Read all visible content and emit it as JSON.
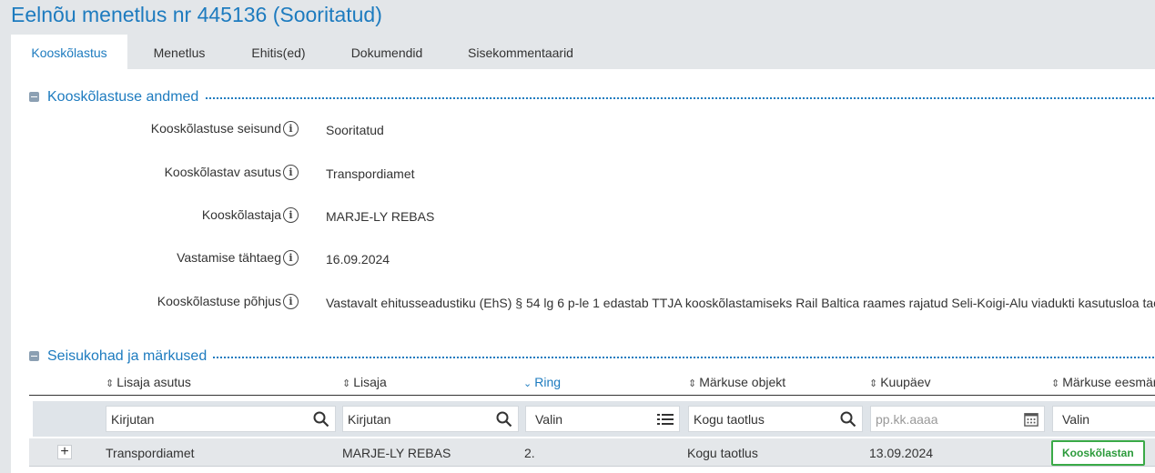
{
  "page": {
    "title": "Eelnõu menetlus nr 445136 (Sooritatud)"
  },
  "tabs": [
    {
      "label": "Kooskõlastus",
      "active": true
    },
    {
      "label": "Menetlus"
    },
    {
      "label": "Ehitis(ed)"
    },
    {
      "label": "Dokumendid"
    },
    {
      "label": "Sisekommentaarid"
    }
  ],
  "details": {
    "title": "Kooskõlastuse andmed",
    "fields": [
      {
        "label": "Kooskõlastuse seisund",
        "value": "Sooritatud"
      },
      {
        "label": "Kooskõlastav asutus",
        "value": "Transpordiamet"
      },
      {
        "label": "Kooskõlastaja",
        "value": "MARJE-LY REBAS"
      },
      {
        "label": "Vastamise tähtaeg",
        "value": "16.09.2024"
      },
      {
        "label": "Kooskõlastuse põhjus",
        "value": "Vastavalt ehitusseadustiku (EhS) § 54 lg 6 p-le 1 edastab TTJA kooskõlastamiseks Rail Baltica raames rajatud Seli-Koigi-Alu viadukti kasutusloa taotluse"
      }
    ]
  },
  "remarks": {
    "title": "Seisukohad ja märkused",
    "columns": [
      {
        "label": "Lisaja asutus",
        "sort": "none"
      },
      {
        "label": "Lisaja",
        "sort": "none"
      },
      {
        "label": "Ring",
        "sort": "desc"
      },
      {
        "label": "Märkuse objekt",
        "sort": "none"
      },
      {
        "label": "Kuupäev",
        "sort": "none"
      },
      {
        "label": "Märkuse eesmärk",
        "sort": "none"
      }
    ],
    "filters": {
      "lisaja_asutus_placeholder": "Kirjutan",
      "lisaja_placeholder": "Kirjutan",
      "ring_placeholder": "Valin",
      "markuse_objekt_value": "Kogu taotlus",
      "kuupaev_placeholder": "pp.kk.aaaa",
      "eesmark_placeholder": "Valin"
    },
    "rows": [
      {
        "lisaja_asutus": "Transpordiamet",
        "lisaja": "MARJE-LY REBAS",
        "ring": "2.",
        "markuse_objekt": "Kogu taotlus",
        "kuupaev": "13.09.2024",
        "eesmark": "Kooskõlastan"
      }
    ]
  },
  "colors": {
    "accent": "#1d7bbf",
    "success": "#3aaa47",
    "background": "#e3e6e9"
  },
  "icons": {
    "collapse": "minus-square-icon",
    "info": "info-circle-icon",
    "sort": "sort-updown-icon",
    "search": "search-icon",
    "list": "list-icon",
    "calendar": "calendar-icon",
    "expand": "plus-icon"
  }
}
